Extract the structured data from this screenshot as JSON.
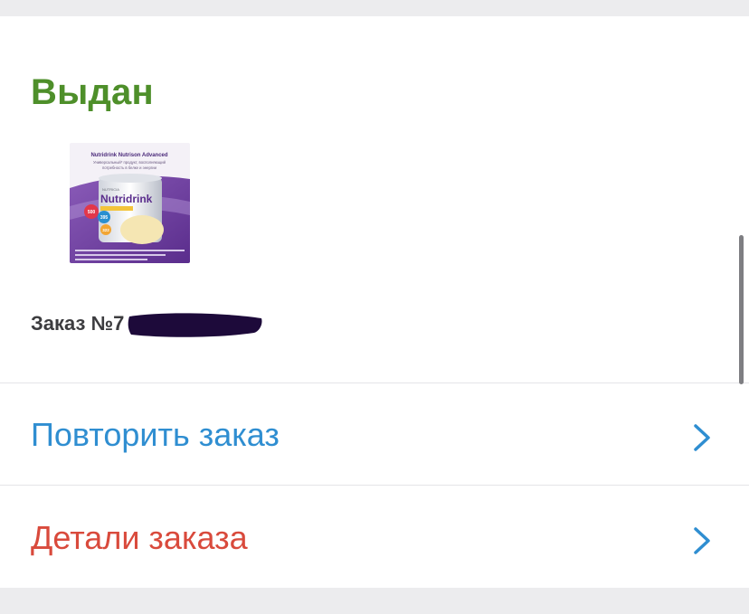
{
  "order_card": {
    "status": "Выдан",
    "order_number": "Заказ №7",
    "status_color": "#4e8f2a",
    "product": {
      "brand": "NUTRICIA",
      "name": "Nutridrink",
      "title_line": "Nutridrink Nutrison Advanced",
      "subtitle_line1": "Универсальный* продукт, восполняющий",
      "subtitle_line2": "потребность в белке и энергии",
      "badge_1": "500",
      "badge_2": "395",
      "badge_3": "322"
    }
  },
  "actions": {
    "repeat_label": "Повторить заказ",
    "repeat_color": "#2f8ed1",
    "details_label": "Детали заказа",
    "details_color": "#d94a3c"
  },
  "icons": {
    "chevron": "chevron-right-icon"
  }
}
